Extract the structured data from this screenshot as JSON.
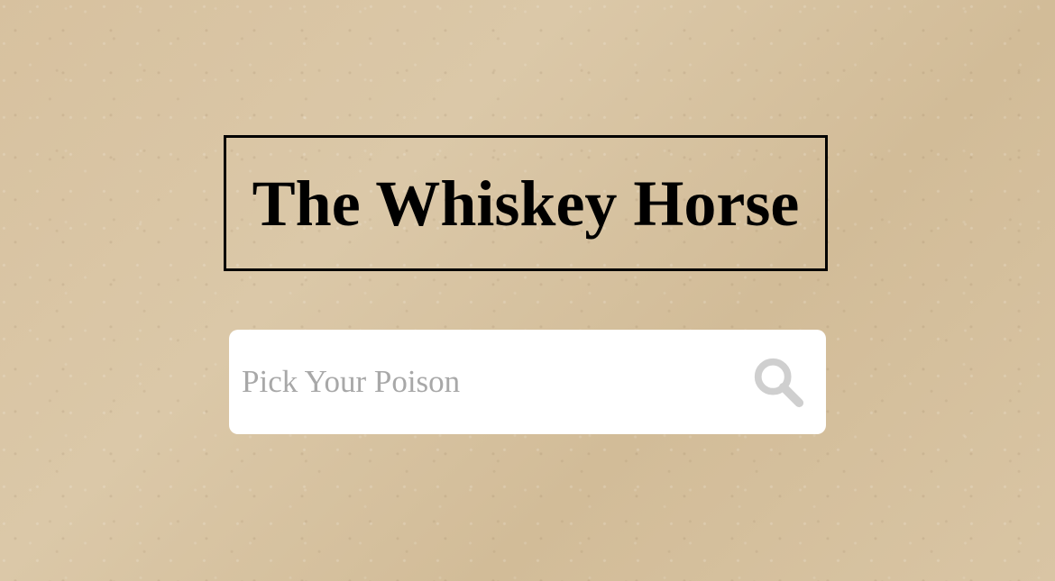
{
  "site": {
    "title": "The Whiskey Horse"
  },
  "search": {
    "placeholder": "Pick Your Poison",
    "value": "",
    "icon": "search-icon"
  },
  "colors": {
    "background": "#d8c4a3",
    "title_text": "#000000",
    "search_background": "#ffffff",
    "placeholder_text": "#a8a8a8",
    "icon": "#cfcfcf"
  }
}
